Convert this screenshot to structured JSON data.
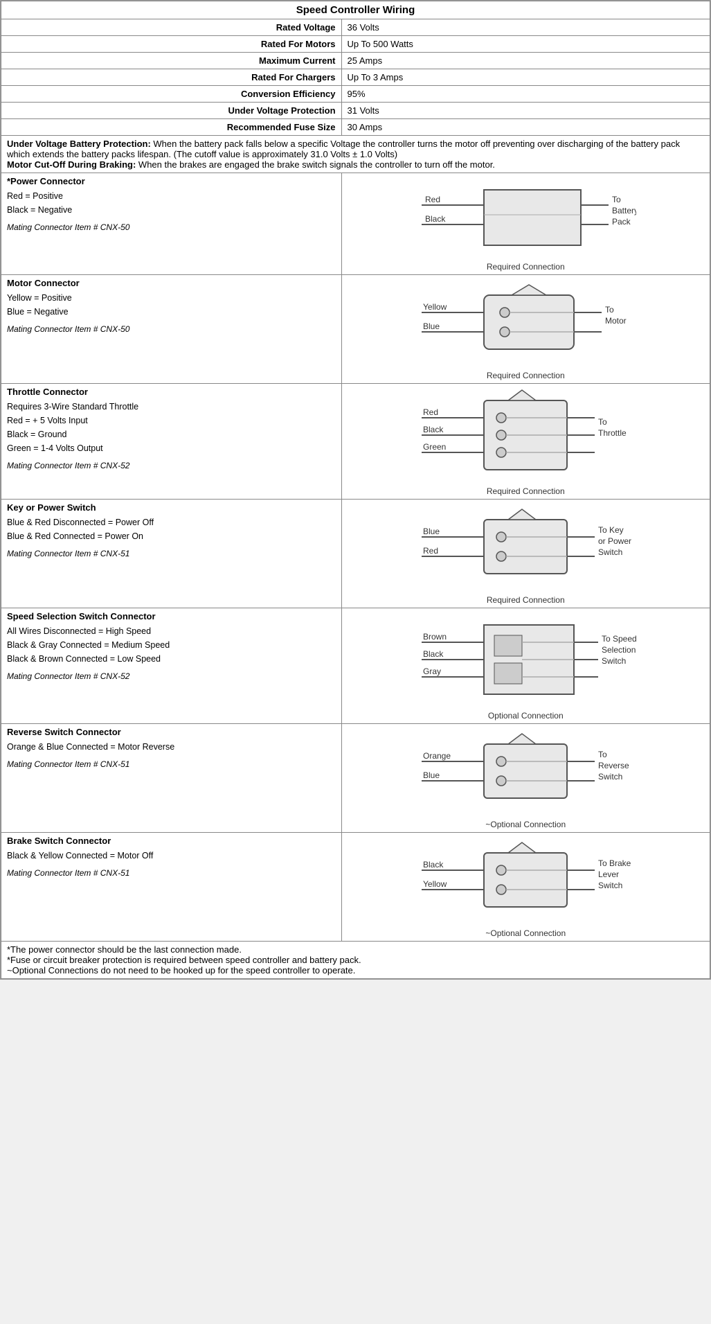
{
  "title": "Speed Controller Wiring",
  "specs": [
    {
      "label": "Rated Voltage",
      "value": "36 Volts"
    },
    {
      "label": "Rated For Motors",
      "value": "Up To 500 Watts"
    },
    {
      "label": "Maximum Current",
      "value": "25 Amps"
    },
    {
      "label": "Rated For Chargers",
      "value": "Up To 3 Amps"
    },
    {
      "label": "Conversion Efficiency",
      "value": "95%"
    },
    {
      "label": "Under Voltage Protection",
      "value": "31 Volts"
    },
    {
      "label": "Recommended Fuse Size",
      "value": "30 Amps"
    }
  ],
  "notes": [
    "Under Voltage Battery Protection: When the battery pack falls below a specific Voltage the controller turns the motor off preventing over discharging of the battery pack which extends the battery packs lifespan. (The cutoff value is approximately 31.0 Volts ± 1.0 Volts)",
    "Motor Cut-Off During Braking: When the brakes are engaged the brake switch signals the controller to turn off the motor."
  ],
  "connectors": [
    {
      "title": "*Power Connector",
      "desc": "Red = Positive\nBlack = Negative",
      "mating": "Mating Connector Item # CNX-50",
      "diagram_type": "battery",
      "connection_label": "Required Connection",
      "to_label": "To\nBattery\nPack",
      "wires": [
        "Red",
        "Black"
      ]
    },
    {
      "title": "Motor Connector",
      "desc": "Yellow = Positive\nBlue = Negative",
      "mating": "Mating Connector Item # CNX-50",
      "diagram_type": "motor",
      "connection_label": "Required Connection",
      "to_label": "To\nMotor",
      "wires": [
        "Yellow",
        "Blue"
      ]
    },
    {
      "title": "Throttle Connector",
      "desc": "Requires 3-Wire Standard Throttle\nRed = + 5 Volts Input\nBlack = Ground\nGreen = 1-4 Volts Output",
      "mating": "Mating Connector Item # CNX-52",
      "diagram_type": "throttle",
      "connection_label": "Required Connection",
      "to_label": "To\nThrottle",
      "wires": [
        "Red",
        "Black",
        "Green"
      ]
    },
    {
      "title": "Key or Power Switch",
      "desc": "Blue & Red Disconnected = Power Off\nBlue & Red Connected = Power On",
      "mating": "Mating Connector Item # CNX-51",
      "diagram_type": "key",
      "connection_label": "Required Connection",
      "to_label": "To Key\nor Power\nSwitch",
      "wires": [
        "Blue",
        "Red"
      ]
    },
    {
      "title": "Speed Selection Switch Connector",
      "desc": "All Wires Disconnected = High Speed\nBlack & Gray Connected = Medium Speed\nBlack & Brown Connected = Low Speed",
      "mating": "Mating Connector Item # CNX-52",
      "diagram_type": "speed",
      "connection_label": "Optional Connection",
      "to_label": "To Speed\nSelection\nSwitch",
      "wires": [
        "Brown",
        "Black",
        "Gray"
      ]
    },
    {
      "title": "Reverse Switch Connector",
      "desc": "Orange & Blue Connected = Motor Reverse",
      "mating": "Mating Connector Item # CNX-51",
      "diagram_type": "reverse",
      "connection_label": "~Optional Connection",
      "to_label": "To\nReverse\nSwitch",
      "wires": [
        "Orange",
        "Blue"
      ]
    },
    {
      "title": "Brake Switch Connector",
      "desc": "Black & Yellow Connected = Motor Off",
      "mating": "Mating Connector Item # CNX-51",
      "diagram_type": "brake",
      "connection_label": "~Optional Connection",
      "to_label": "To Brake\nLever\nSwitch",
      "wires": [
        "Black",
        "Yellow"
      ]
    }
  ],
  "footer": [
    "*The power connector should be the last connection made.",
    "*Fuse or circuit breaker protection is required between speed controller and battery pack.",
    "~Optional Connections do not need to be hooked up for the speed controller to operate."
  ]
}
